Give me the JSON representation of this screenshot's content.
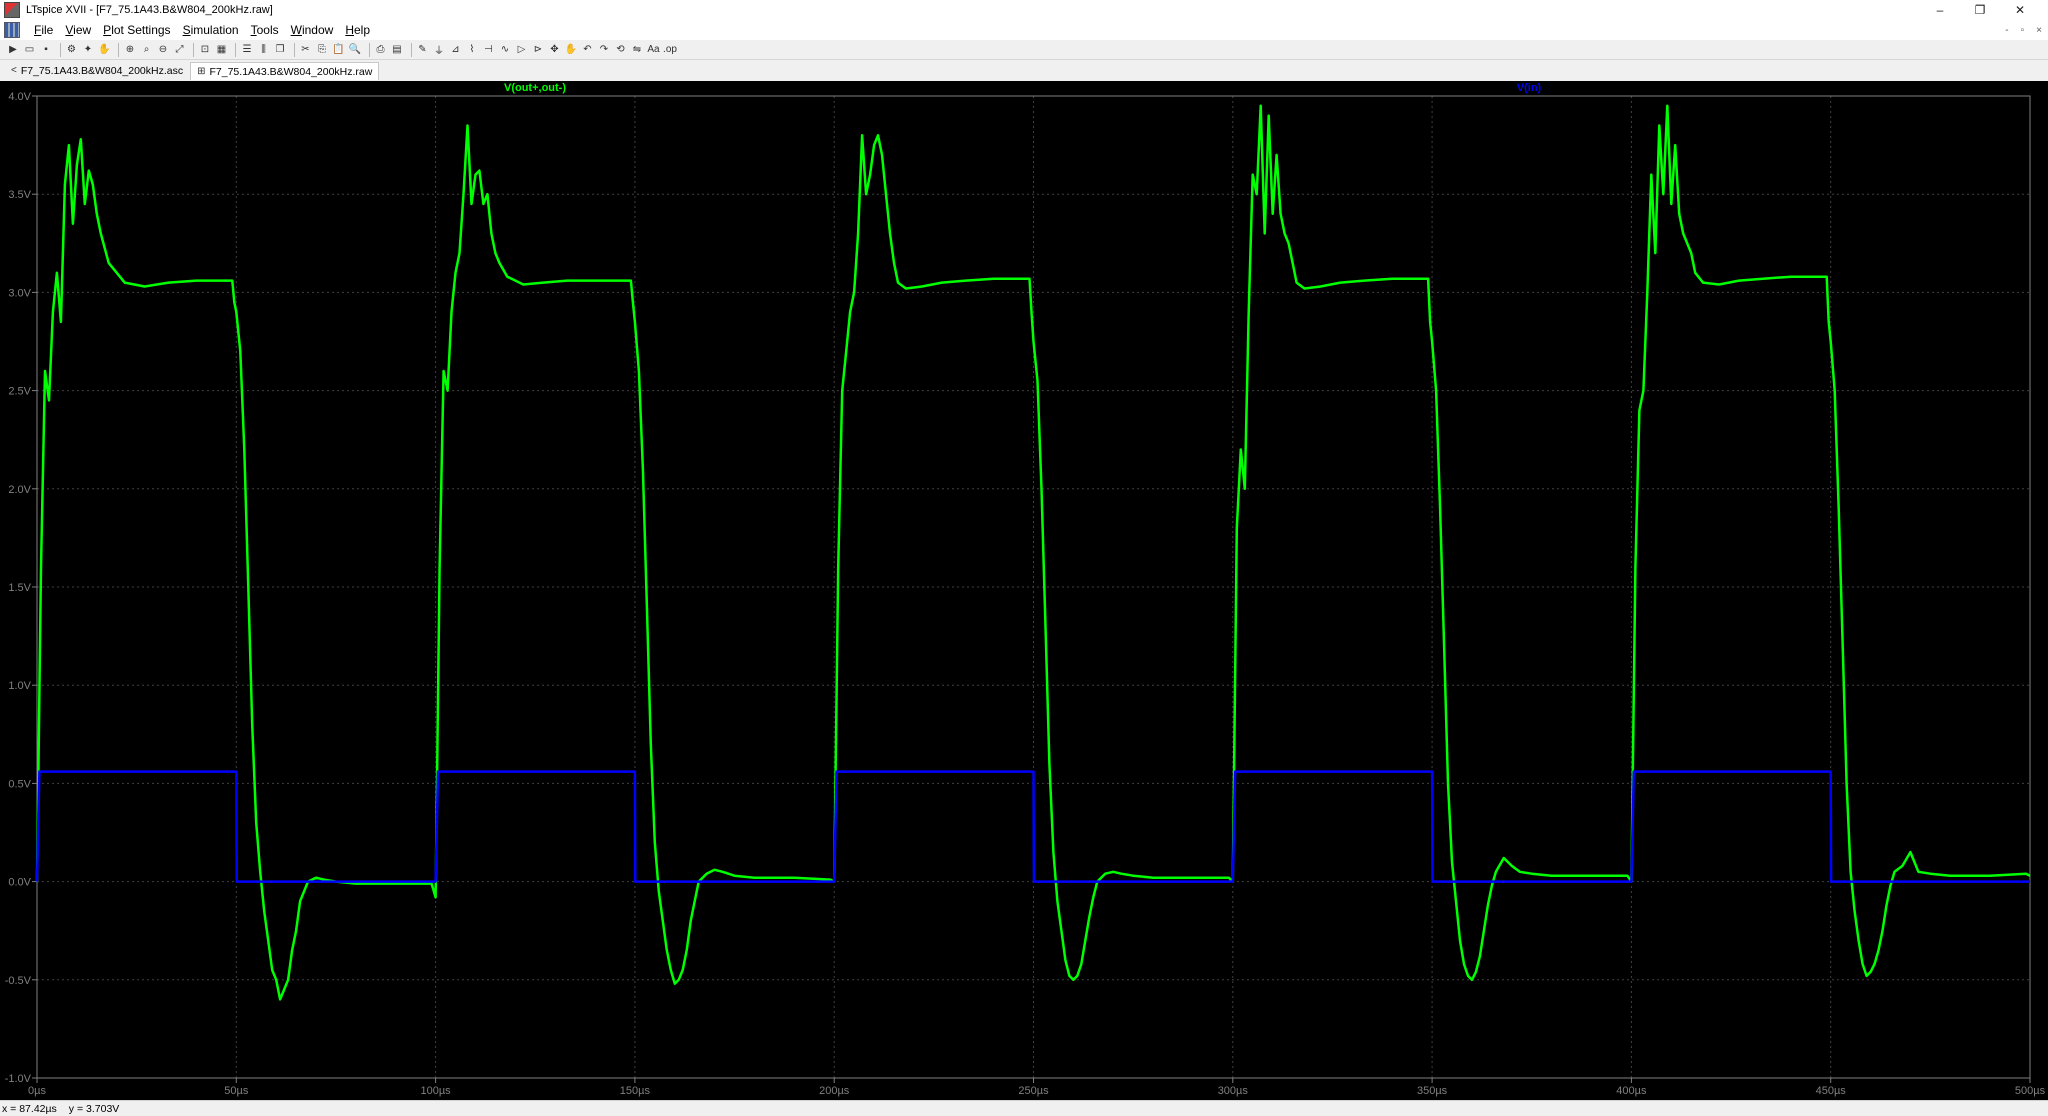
{
  "window": {
    "title": "LTspice XVII - [F7_75.1A43.B&W804_200kHz.raw]",
    "controls": {
      "minimize": "–",
      "restore": "❐",
      "close": "✕"
    }
  },
  "menu": {
    "items": [
      "File",
      "View",
      "Plot Settings",
      "Simulation",
      "Tools",
      "Window",
      "Help"
    ],
    "mdi_controls": {
      "minimize": "-",
      "restore": "▫",
      "close": "×"
    }
  },
  "tabs": [
    {
      "label": "F7_75.1A43.B&W804_200kHz.asc",
      "icon": "schematic-icon",
      "glyph": "<",
      "active": false
    },
    {
      "label": "F7_75.1A43.B&W804_200kHz.raw",
      "icon": "waveform-icon",
      "glyph": "⊞",
      "active": true
    }
  ],
  "toolbar": {
    "groups": [
      [
        {
          "name": "run-icon",
          "glyph": "▶"
        },
        {
          "name": "open-icon",
          "glyph": "▭"
        },
        {
          "name": "save-icon",
          "glyph": "▪"
        }
      ],
      [
        {
          "name": "control-panel-icon",
          "glyph": "⚙"
        },
        {
          "name": "run-simulation-icon",
          "glyph": "✦"
        },
        {
          "name": "halt-icon",
          "glyph": "✋"
        }
      ],
      [
        {
          "name": "zoom-in-icon",
          "glyph": "⊕"
        },
        {
          "name": "zoom-area-icon",
          "glyph": "⌕"
        },
        {
          "name": "zoom-out-icon",
          "glyph": "⊖"
        },
        {
          "name": "zoom-fit-icon",
          "glyph": "⤢"
        }
      ],
      [
        {
          "name": "autorange-icon",
          "glyph": "⊡"
        },
        {
          "name": "grid-icon",
          "glyph": "▦"
        }
      ],
      [
        {
          "name": "tile-horizontal-icon",
          "glyph": "☰"
        },
        {
          "name": "tile-vertical-icon",
          "glyph": "⫼"
        },
        {
          "name": "cascade-icon",
          "glyph": "❐"
        }
      ],
      [
        {
          "name": "cut-icon",
          "glyph": "✂"
        },
        {
          "name": "copy-icon",
          "glyph": "⎘"
        },
        {
          "name": "paste-icon",
          "glyph": "📋"
        },
        {
          "name": "find-icon",
          "glyph": "🔍"
        }
      ],
      [
        {
          "name": "print-icon",
          "glyph": "⎙"
        },
        {
          "name": "print-setup-icon",
          "glyph": "▤"
        }
      ],
      [
        {
          "name": "wire-icon",
          "glyph": "✎"
        },
        {
          "name": "ground-icon",
          "glyph": "⏚"
        },
        {
          "name": "label-icon",
          "glyph": "⊿"
        },
        {
          "name": "resistor-icon",
          "glyph": "⌇"
        },
        {
          "name": "capacitor-icon",
          "glyph": "⊣"
        },
        {
          "name": "inductor-icon",
          "glyph": "∿"
        },
        {
          "name": "diode-icon",
          "glyph": "▷"
        },
        {
          "name": "component-icon",
          "glyph": "⊳"
        },
        {
          "name": "move-icon",
          "glyph": "✥"
        },
        {
          "name": "drag-icon",
          "glyph": "✋"
        },
        {
          "name": "undo-icon",
          "glyph": "↶"
        },
        {
          "name": "redo-icon",
          "glyph": "↷"
        },
        {
          "name": "rotate-icon",
          "glyph": "⟲"
        },
        {
          "name": "mirror-icon",
          "glyph": "⇋"
        },
        {
          "name": "text-icon",
          "glyph": "Aa"
        },
        {
          "name": "spice-directive-icon",
          "glyph": ".op"
        }
      ]
    ]
  },
  "status": {
    "x": "x = 87.42µs",
    "y": "y = 3.703V"
  },
  "colors": {
    "plot_bg": "#000000",
    "axis": "#808080",
    "grid": "#404040",
    "trace_out": "#00ff00",
    "trace_in": "#0000ff",
    "label_out": "#00ff00",
    "label_in": "#0000ff"
  },
  "chart_data": {
    "type": "line",
    "title": "",
    "xlabel": "",
    "ylabel": "",
    "xlim": [
      0,
      500
    ],
    "ylim": [
      -1.0,
      4.0
    ],
    "grid": true,
    "x_ticks": [
      "0µs",
      "50µs",
      "100µs",
      "150µs",
      "200µs",
      "250µs",
      "300µs",
      "350µs",
      "400µs",
      "450µs",
      "500µs"
    ],
    "y_ticks": [
      "4.0V",
      "3.5V",
      "3.0V",
      "2.5V",
      "2.0V",
      "1.5V",
      "1.0V",
      "0.5V",
      "0.0V",
      "-0.5V",
      "-1.0V"
    ],
    "x_tick_values": [
      0,
      50,
      100,
      150,
      200,
      250,
      300,
      350,
      400,
      450,
      500
    ],
    "y_tick_values": [
      4.0,
      3.5,
      3.0,
      2.5,
      2.0,
      1.5,
      1.0,
      0.5,
      0.0,
      -0.5,
      -1.0
    ],
    "series": [
      {
        "name": "V(out+,out-)",
        "color": "#00ff00",
        "x": [
          0,
          1,
          2,
          3,
          4,
          5,
          6,
          7,
          8,
          9,
          10,
          11,
          12,
          13,
          14,
          15,
          16,
          18,
          22,
          27,
          33,
          40,
          45,
          49,
          49.5,
          50,
          51,
          52,
          53,
          54,
          55,
          56,
          57,
          58,
          59,
          60,
          61,
          62,
          63,
          64,
          65,
          66,
          68,
          70,
          72,
          75,
          80,
          90,
          99,
          100,
          101,
          102,
          103,
          104,
          105,
          106,
          107,
          108,
          109,
          110,
          111,
          112,
          113,
          114,
          115,
          116,
          118,
          122,
          127,
          133,
          140,
          145,
          149,
          149.5,
          150,
          151,
          152,
          153,
          154,
          155,
          156,
          157,
          158,
          159,
          160,
          161,
          162,
          163,
          164,
          165,
          166,
          168,
          170,
          172,
          175,
          180,
          190,
          199,
          200,
          201,
          202,
          203,
          204,
          205,
          206,
          207,
          208,
          209,
          210,
          211,
          212,
          213,
          214,
          215,
          216,
          218,
          222,
          227,
          233,
          240,
          245,
          249,
          249.5,
          250,
          251,
          252,
          253,
          254,
          255,
          256,
          257,
          258,
          259,
          260,
          261,
          262,
          263,
          264,
          265,
          266,
          268,
          270,
          272,
          275,
          280,
          290,
          299,
          300,
          301,
          302,
          303,
          304,
          305,
          306,
          307,
          308,
          309,
          310,
          311,
          312,
          313,
          314,
          315,
          316,
          318,
          322,
          327,
          333,
          340,
          345,
          349,
          349.5,
          350,
          351,
          352,
          353,
          354,
          355,
          356,
          357,
          358,
          359,
          360,
          361,
          362,
          363,
          364,
          365,
          366,
          368,
          370,
          372,
          375,
          380,
          390,
          399,
          400,
          401,
          402,
          403,
          404,
          405,
          406,
          407,
          408,
          409,
          410,
          411,
          412,
          413,
          414,
          415,
          416,
          418,
          422,
          427,
          433,
          440,
          445,
          449,
          449.5,
          450,
          451,
          452,
          453,
          454,
          455,
          456,
          457,
          458,
          459,
          460,
          461,
          462,
          463,
          464,
          465,
          466,
          468,
          470,
          472,
          475,
          480,
          490,
          499,
          500
        ],
        "y": [
          0.0,
          1.6,
          2.6,
          2.45,
          2.9,
          3.1,
          2.85,
          3.55,
          3.75,
          3.35,
          3.65,
          3.78,
          3.45,
          3.62,
          3.55,
          3.4,
          3.3,
          3.15,
          3.05,
          3.03,
          3.05,
          3.06,
          3.06,
          3.06,
          2.95,
          2.9,
          2.7,
          2.2,
          1.5,
          0.8,
          0.3,
          0.05,
          -0.15,
          -0.3,
          -0.45,
          -0.5,
          -0.6,
          -0.55,
          -0.5,
          -0.35,
          -0.25,
          -0.1,
          0.0,
          0.02,
          0.01,
          0.0,
          -0.01,
          -0.01,
          -0.01,
          -0.08,
          1.6,
          2.6,
          2.5,
          2.9,
          3.1,
          3.2,
          3.5,
          3.85,
          3.45,
          3.6,
          3.62,
          3.45,
          3.5,
          3.3,
          3.2,
          3.15,
          3.08,
          3.04,
          3.05,
          3.06,
          3.06,
          3.06,
          3.06,
          2.95,
          2.85,
          2.6,
          2.1,
          1.4,
          0.7,
          0.2,
          -0.05,
          -0.2,
          -0.35,
          -0.45,
          -0.52,
          -0.5,
          -0.45,
          -0.35,
          -0.2,
          -0.1,
          0.0,
          0.04,
          0.06,
          0.05,
          0.03,
          0.02,
          0.02,
          0.01,
          0.0,
          1.6,
          2.5,
          2.7,
          2.9,
          3.0,
          3.3,
          3.8,
          3.5,
          3.6,
          3.75,
          3.8,
          3.7,
          3.5,
          3.3,
          3.15,
          3.05,
          3.02,
          3.03,
          3.05,
          3.06,
          3.07,
          3.07,
          3.07,
          2.9,
          2.75,
          2.55,
          2.0,
          1.3,
          0.6,
          0.15,
          -0.1,
          -0.25,
          -0.4,
          -0.48,
          -0.5,
          -0.48,
          -0.42,
          -0.3,
          -0.18,
          -0.08,
          0.0,
          0.04,
          0.05,
          0.04,
          0.03,
          0.02,
          0.02,
          0.02,
          0.0,
          1.8,
          2.2,
          2.0,
          2.9,
          3.6,
          3.5,
          3.95,
          3.3,
          3.9,
          3.4,
          3.7,
          3.4,
          3.3,
          3.25,
          3.15,
          3.05,
          3.02,
          3.03,
          3.05,
          3.06,
          3.07,
          3.07,
          3.07,
          2.85,
          2.75,
          2.5,
          1.9,
          1.2,
          0.5,
          0.1,
          -0.1,
          -0.3,
          -0.42,
          -0.48,
          -0.5,
          -0.46,
          -0.38,
          -0.25,
          -0.12,
          -0.02,
          0.05,
          0.12,
          0.08,
          0.05,
          0.04,
          0.03,
          0.03,
          0.03,
          0.0,
          1.6,
          2.4,
          2.5,
          3.0,
          3.6,
          3.2,
          3.85,
          3.5,
          3.95,
          3.45,
          3.75,
          3.4,
          3.3,
          3.25,
          3.2,
          3.1,
          3.05,
          3.04,
          3.06,
          3.07,
          3.08,
          3.08,
          3.08,
          2.85,
          2.75,
          2.5,
          1.9,
          1.2,
          0.5,
          0.05,
          -0.15,
          -0.3,
          -0.42,
          -0.48,
          -0.46,
          -0.42,
          -0.35,
          -0.25,
          -0.12,
          -0.02,
          0.05,
          0.08,
          0.15,
          0.05,
          0.04,
          0.03,
          0.03,
          0.04,
          0.03
        ]
      },
      {
        "name": "V(in)",
        "color": "#0000ff",
        "x": [
          0,
          0.6,
          50,
          50.1,
          100,
          100.6,
          150,
          150.1,
          200,
          200.6,
          250,
          250.1,
          300,
          300.6,
          350,
          350.1,
          400,
          400.6,
          450,
          450.1,
          500
        ],
        "y": [
          0.0,
          0.56,
          0.56,
          0.0,
          0.0,
          0.56,
          0.56,
          0.0,
          0.0,
          0.56,
          0.56,
          0.0,
          0.0,
          0.56,
          0.56,
          0.0,
          0.0,
          0.56,
          0.56,
          0.0,
          0.0
        ]
      }
    ]
  }
}
